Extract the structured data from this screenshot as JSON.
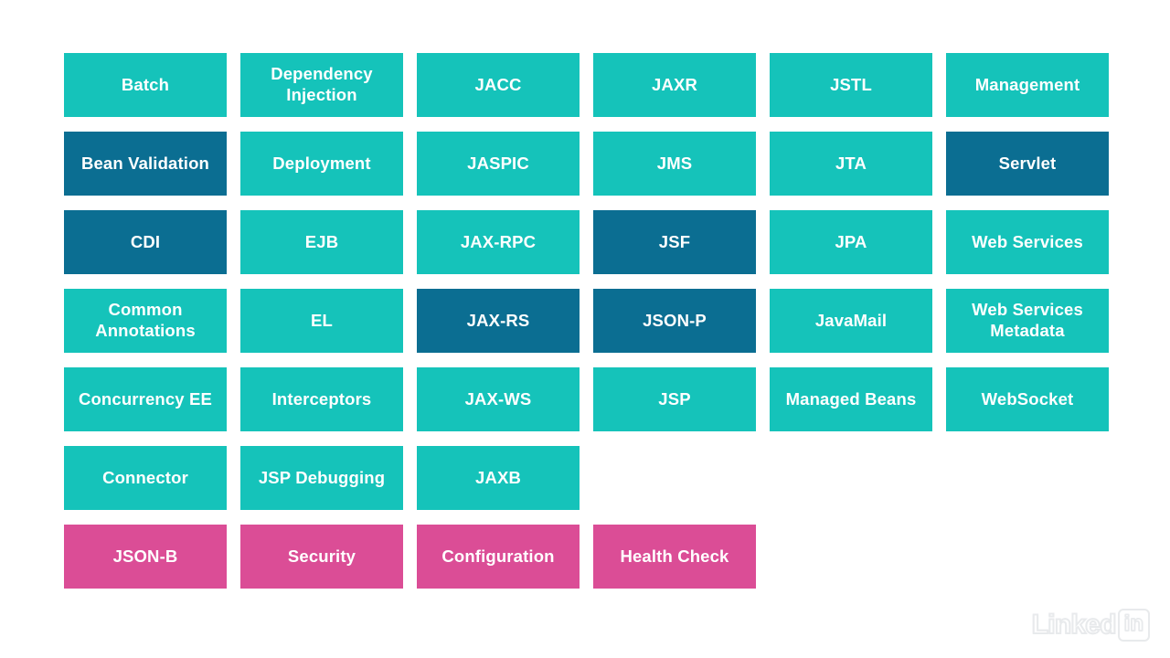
{
  "slide": {
    "background_color": "#FFFFFF",
    "title": "",
    "palette": {
      "teal": "#15C3BA",
      "dark_blue": "#0B6E92",
      "pink": "#DB4D96",
      "tile_text": "#FFFFFF",
      "watermark": "#E8EAEC",
      "edge_strip": "#111417"
    }
  },
  "watermark": {
    "word": "Linked",
    "badge": "in"
  },
  "grid": {
    "columns": 6,
    "rows": 7,
    "tiles": [
      {
        "label": "Batch",
        "color_key": "teal",
        "color": "#15C3BA",
        "lines": 1
      },
      {
        "label": "Dependency Injection",
        "color_key": "teal",
        "color": "#15C3BA",
        "lines": 2
      },
      {
        "label": "JACC",
        "color_key": "teal",
        "color": "#15C3BA",
        "lines": 1
      },
      {
        "label": "JAXR",
        "color_key": "teal",
        "color": "#15C3BA",
        "lines": 1
      },
      {
        "label": "JSTL",
        "color_key": "teal",
        "color": "#15C3BA",
        "lines": 1
      },
      {
        "label": "Management",
        "color_key": "teal",
        "color": "#15C3BA",
        "lines": 1
      },
      {
        "label": "Bean Validation",
        "color_key": "dark_blue",
        "color": "#0B6E92",
        "lines": 2
      },
      {
        "label": "Deployment",
        "color_key": "teal",
        "color": "#15C3BA",
        "lines": 1
      },
      {
        "label": "JASPIC",
        "color_key": "teal",
        "color": "#15C3BA",
        "lines": 1
      },
      {
        "label": "JMS",
        "color_key": "teal",
        "color": "#15C3BA",
        "lines": 1
      },
      {
        "label": "JTA",
        "color_key": "teal",
        "color": "#15C3BA",
        "lines": 1
      },
      {
        "label": "Servlet",
        "color_key": "dark_blue",
        "color": "#0B6E92",
        "lines": 1
      },
      {
        "label": "CDI",
        "color_key": "dark_blue",
        "color": "#0B6E92",
        "lines": 1
      },
      {
        "label": "EJB",
        "color_key": "teal",
        "color": "#15C3BA",
        "lines": 1
      },
      {
        "label": "JAX-RPC",
        "color_key": "teal",
        "color": "#15C3BA",
        "lines": 1
      },
      {
        "label": "JSF",
        "color_key": "dark_blue",
        "color": "#0B6E92",
        "lines": 1
      },
      {
        "label": "JPA",
        "color_key": "teal",
        "color": "#15C3BA",
        "lines": 1
      },
      {
        "label": "Web Services",
        "color_key": "teal",
        "color": "#15C3BA",
        "lines": 1
      },
      {
        "label": "Common Annotations",
        "color_key": "teal",
        "color": "#15C3BA",
        "lines": 2
      },
      {
        "label": "EL",
        "color_key": "teal",
        "color": "#15C3BA",
        "lines": 1
      },
      {
        "label": "JAX-RS",
        "color_key": "dark_blue",
        "color": "#0B6E92",
        "lines": 1
      },
      {
        "label": "JSON-P",
        "color_key": "dark_blue",
        "color": "#0B6E92",
        "lines": 1
      },
      {
        "label": "JavaMail",
        "color_key": "teal",
        "color": "#15C3BA",
        "lines": 1
      },
      {
        "label": "Web Services Metadata",
        "color_key": "teal",
        "color": "#15C3BA",
        "lines": 2
      },
      {
        "label": "Concurrency EE",
        "color_key": "teal",
        "color": "#15C3BA",
        "lines": 2
      },
      {
        "label": "Interceptors",
        "color_key": "teal",
        "color": "#15C3BA",
        "lines": 1
      },
      {
        "label": "JAX-WS",
        "color_key": "teal",
        "color": "#15C3BA",
        "lines": 1
      },
      {
        "label": "JSP",
        "color_key": "teal",
        "color": "#15C3BA",
        "lines": 1
      },
      {
        "label": "Managed Beans",
        "color_key": "teal",
        "color": "#15C3BA",
        "lines": 2
      },
      {
        "label": "WebSocket",
        "color_key": "teal",
        "color": "#15C3BA",
        "lines": 1
      },
      {
        "label": "Connector",
        "color_key": "teal",
        "color": "#15C3BA",
        "lines": 1
      },
      {
        "label": "JSP Debugging",
        "color_key": "teal",
        "color": "#15C3BA",
        "lines": 2
      },
      {
        "label": "JAXB",
        "color_key": "teal",
        "color": "#15C3BA",
        "lines": 1
      },
      {
        "label": "",
        "color_key": "none",
        "color": "transparent",
        "lines": 0
      },
      {
        "label": "",
        "color_key": "none",
        "color": "transparent",
        "lines": 0
      },
      {
        "label": "",
        "color_key": "none",
        "color": "transparent",
        "lines": 0
      },
      {
        "label": "JSON-B",
        "color_key": "pink",
        "color": "#DB4D96",
        "lines": 1
      },
      {
        "label": "Security",
        "color_key": "pink",
        "color": "#DB4D96",
        "lines": 1
      },
      {
        "label": "Configuration",
        "color_key": "pink",
        "color": "#DB4D96",
        "lines": 1
      },
      {
        "label": "Health Check",
        "color_key": "pink",
        "color": "#DB4D96",
        "lines": 1
      },
      {
        "label": "",
        "color_key": "none",
        "color": "transparent",
        "lines": 0
      },
      {
        "label": "",
        "color_key": "none",
        "color": "transparent",
        "lines": 0
      }
    ]
  }
}
